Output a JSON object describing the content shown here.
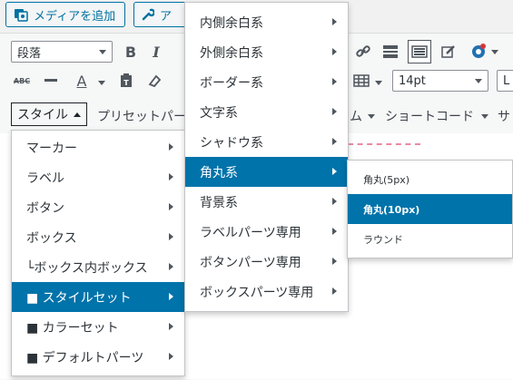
{
  "top_buttons": {
    "add_media_label": "メディアを追加",
    "second_label": "ア"
  },
  "toolbar1": {
    "format_select": "段落",
    "bold": "B",
    "italic": "I"
  },
  "toolbar2": {
    "strike": "ABC",
    "textcolor": "A",
    "fontsize_select": "14pt",
    "fontfamily_select": "L"
  },
  "toolbar3": {
    "style_button": "スタイル",
    "preset_label": "プリセットパー",
    "partial_item": "ム",
    "shortcode_label": "ショートコード",
    "last_partial": "サ"
  },
  "menu1": {
    "items": [
      "マーカー",
      "ラベル",
      "ボタン",
      "ボックス",
      "└ボックス内ボックス",
      "■ スタイルセット",
      "■ カラーセット",
      "■ デフォルトパーツ"
    ]
  },
  "menu2": {
    "items": [
      "内側余白系",
      "外側余白系",
      "ボーダー系",
      "文字系",
      "シャドウ系",
      "角丸系",
      "背景系",
      "ラベルパーツ専用",
      "ボタンパーツ専用",
      "ボックスパーツ専用"
    ]
  },
  "menu3": {
    "items": [
      "角丸(5px)",
      "角丸(10px)",
      "ラウンド"
    ]
  },
  "colors": {
    "accent": "#0073aa",
    "button_border": "#0071a1",
    "dashed_pink": "#ea8ba4"
  }
}
